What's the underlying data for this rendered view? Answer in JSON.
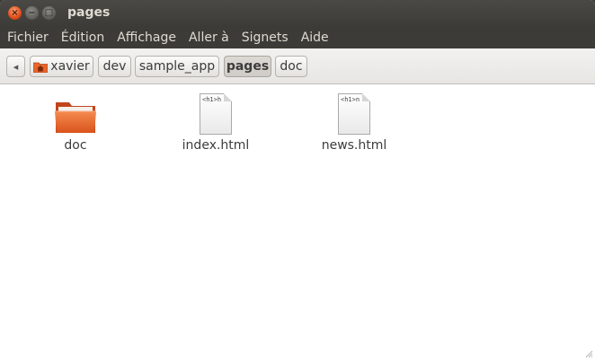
{
  "window": {
    "title": "pages",
    "controls": {
      "close": "×",
      "minimize": "−",
      "maximize": "□"
    }
  },
  "menubar": {
    "items": [
      "Fichier",
      "Édition",
      "Affichage",
      "Aller à",
      "Signets",
      "Aide"
    ]
  },
  "toolbar": {
    "back_glyph": "◂",
    "breadcrumbs": [
      {
        "label": "xavier",
        "icon": "home-folder-icon"
      },
      {
        "label": "dev"
      },
      {
        "label": "sample_app"
      },
      {
        "label": "pages",
        "active": true
      },
      {
        "label": "doc"
      }
    ]
  },
  "files": [
    {
      "name": "doc",
      "type": "folder",
      "icon": "folder-icon"
    },
    {
      "name": "index.html",
      "type": "html",
      "icon": "html-file-icon",
      "preview": "<h1>h"
    },
    {
      "name": "news.html",
      "type": "html",
      "icon": "html-file-icon",
      "preview": "<h1>n"
    }
  ],
  "colors": {
    "titlebar": "#3c3b37",
    "close_button": "#df4b16",
    "folder": "#e8652c"
  }
}
